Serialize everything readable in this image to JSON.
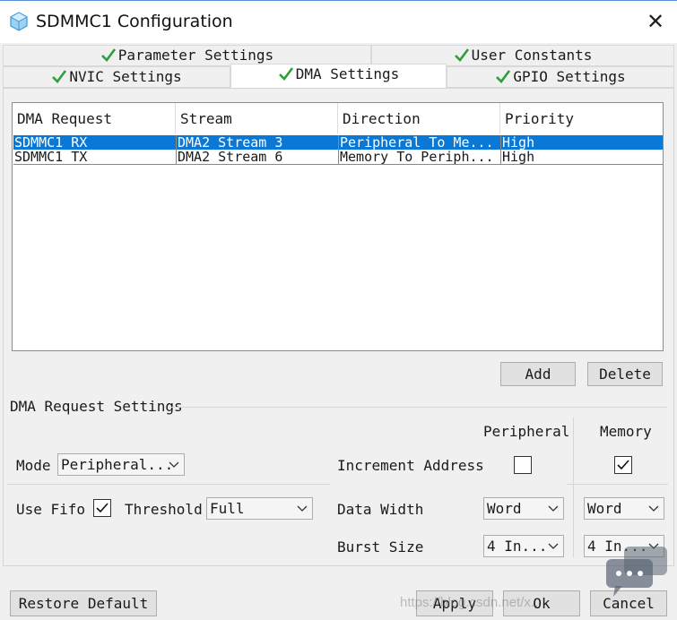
{
  "window": {
    "title": "SDMMC1 Configuration",
    "close_label": "✕"
  },
  "tabs": {
    "row1": [
      {
        "label": "Parameter Settings",
        "checked": true
      },
      {
        "label": "User Constants",
        "checked": true
      }
    ],
    "row2": [
      {
        "label": "NVIC Settings",
        "checked": true
      },
      {
        "label": "DMA Settings",
        "checked": true,
        "active": true
      },
      {
        "label": "GPIO Settings",
        "checked": true
      }
    ]
  },
  "dma_table": {
    "headers": [
      "DMA Request",
      "Stream",
      "Direction",
      "Priority"
    ],
    "rows": [
      {
        "request": "SDMMC1_RX",
        "stream": "DMA2 Stream 3",
        "direction": "Peripheral To Me...",
        "priority": "High",
        "selected": true
      },
      {
        "request": "SDMMC1_TX",
        "stream": "DMA2 Stream 6",
        "direction": "Memory To Periph...",
        "priority": "High",
        "selected": false
      }
    ]
  },
  "buttons": {
    "add": "Add",
    "delete": "Delete",
    "restore_default": "Restore Default",
    "apply": "Apply",
    "ok": "Ok",
    "cancel": "Cancel"
  },
  "settings": {
    "section_title": "DMA Request Settings",
    "col_peripheral": "Peripheral",
    "col_memory": "Memory",
    "mode_label": "Mode",
    "mode_value": "Peripheral...",
    "increment_label": "Increment Address",
    "increment_peripheral": false,
    "increment_memory": true,
    "use_fifo_label": "Use Fifo",
    "use_fifo": true,
    "threshold_label": "Threshold",
    "threshold_value": "Full",
    "data_width_label": "Data Width",
    "data_width_peripheral": "Word",
    "data_width_memory": "Word",
    "burst_size_label": "Burst Size",
    "burst_size_peripheral": "4 In...",
    "burst_size_memory": "4 In..."
  },
  "watermark": "https://blog.csdn.net/x...",
  "colors": {
    "selection": "#0a78d7",
    "check_green": "#2e9e3a",
    "icon_blue": "#3a9ad9"
  }
}
